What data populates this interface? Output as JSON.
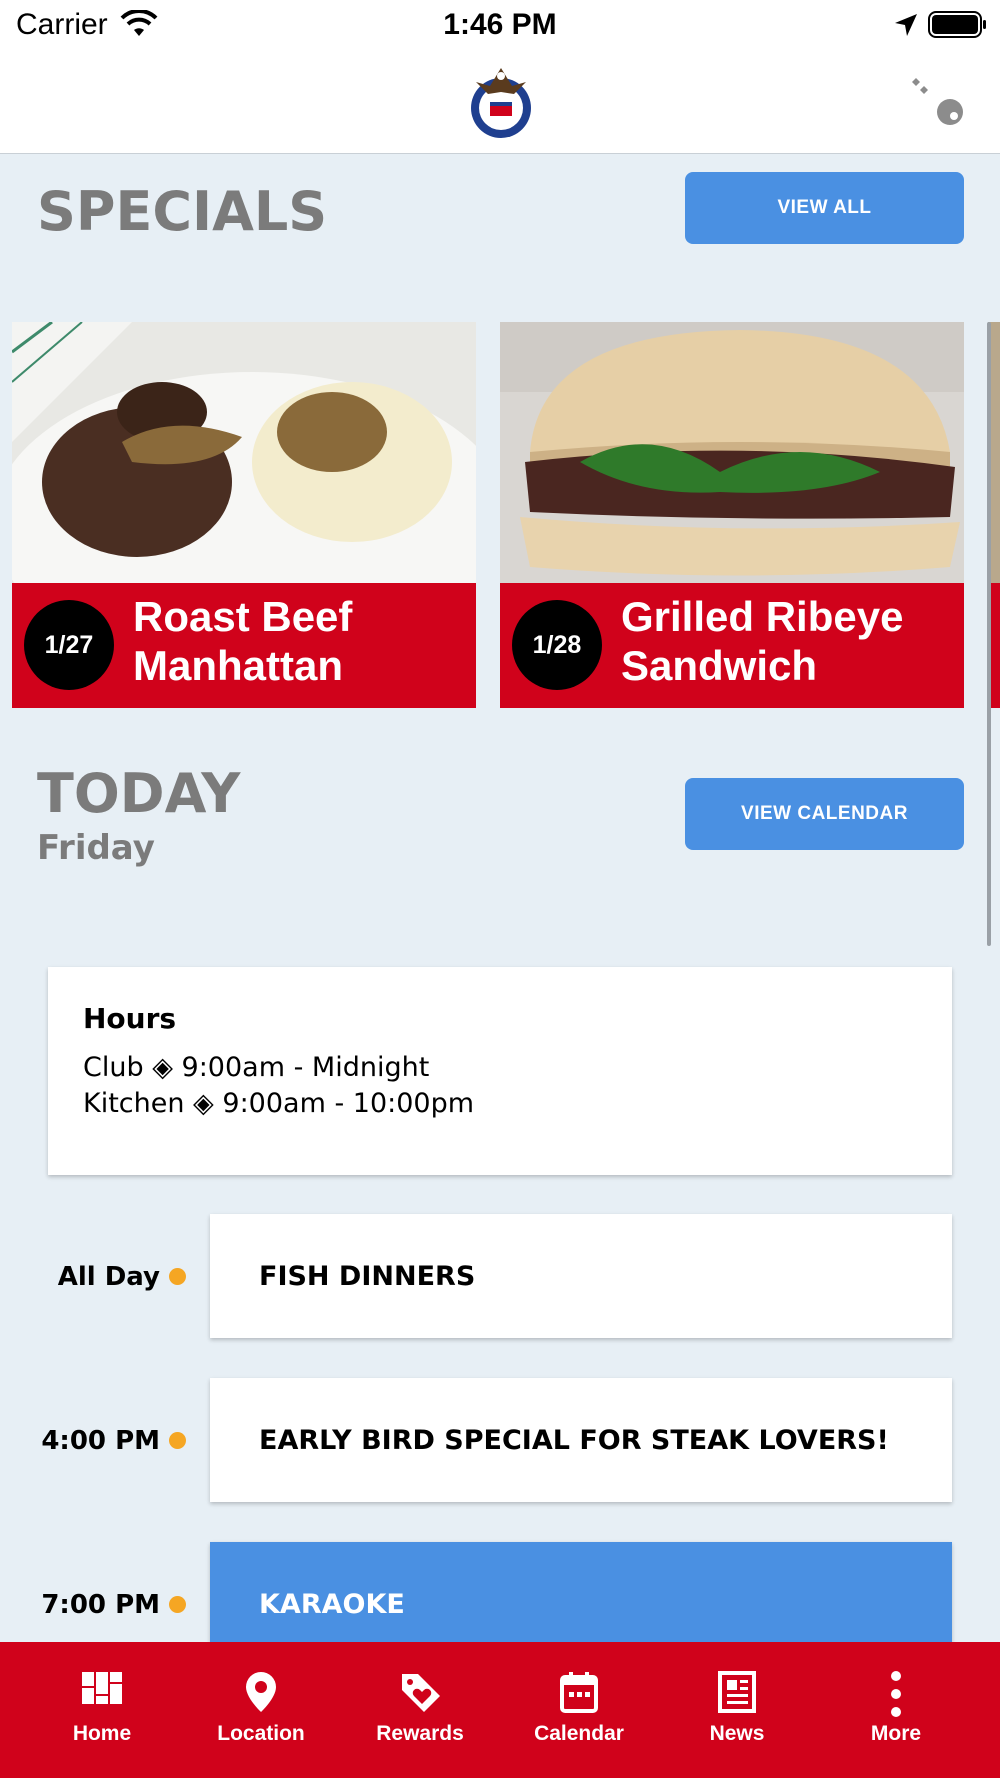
{
  "status_bar": {
    "carrier": "Carrier",
    "time": "1:46 PM"
  },
  "header": {
    "logo_icon": "eagle-seal-logo",
    "login_icon": "key-icon"
  },
  "specials": {
    "title": "SPECIALS",
    "view_all_label": "VIEW ALL",
    "cards": [
      {
        "date": "1/27",
        "title": "Roast Beef Manhattan",
        "image": "roast-beef-photo"
      },
      {
        "date": "1/28",
        "title": "Grilled Ribeye Sandwich",
        "image": "ribeye-sandwich-photo"
      }
    ]
  },
  "today": {
    "title": "TODAY",
    "day": "Friday",
    "view_calendar_label": "VIEW CALENDAR",
    "hours": {
      "title": "Hours",
      "lines": [
        "Club ◈ 9:00am - Midnight",
        "Kitchen ◈ 9:00am - 10:00pm"
      ]
    },
    "events": [
      {
        "time": "All Day",
        "title": "FISH DINNERS",
        "highlight": false
      },
      {
        "time": "4:00 PM",
        "title": "EARLY BIRD SPECIAL FOR STEAK LOVERS!",
        "highlight": false
      },
      {
        "time": "7:00 PM",
        "title": "KARAOKE",
        "highlight": true
      }
    ]
  },
  "tab_bar": {
    "items": [
      {
        "label": "Home",
        "icon": "home-grid-icon"
      },
      {
        "label": "Location",
        "icon": "map-pin-icon"
      },
      {
        "label": "Rewards",
        "icon": "heart-tag-icon"
      },
      {
        "label": "Calendar",
        "icon": "calendar-icon"
      },
      {
        "label": "News",
        "icon": "newspaper-icon"
      },
      {
        "label": "More",
        "icon": "more-dots-icon"
      }
    ]
  },
  "colors": {
    "brand_red": "#d0021b",
    "accent_blue": "#4a90e2",
    "dot_orange": "#f5a623",
    "background": "#e7eff5"
  }
}
